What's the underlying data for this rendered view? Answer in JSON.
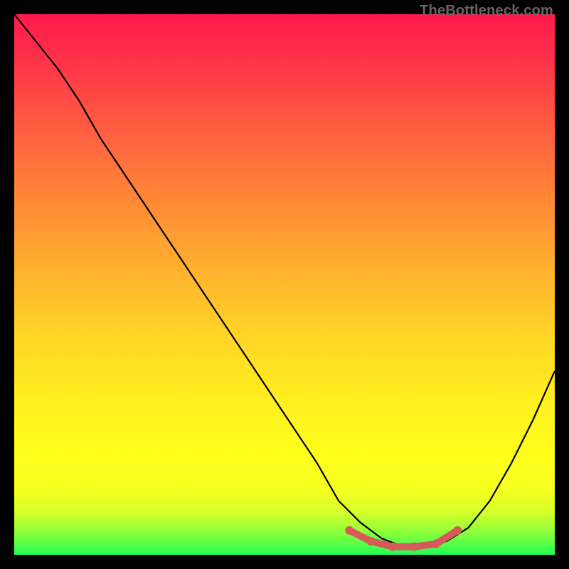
{
  "watermark": "TheBottleneck.com",
  "colors": {
    "curve": "#000000",
    "highlight": "#d65a5a",
    "gradient_top": "#ff1a4d",
    "gradient_bottom": "#20ff55",
    "frame": "#000000"
  },
  "chart_data": {
    "type": "line",
    "title": "",
    "xlabel": "",
    "ylabel": "",
    "xlim": [
      0,
      100
    ],
    "ylim": [
      0,
      100
    ],
    "grid": false,
    "legend": false,
    "x": [
      0,
      4,
      8,
      12,
      16,
      20,
      24,
      28,
      32,
      36,
      40,
      44,
      48,
      52,
      56,
      60,
      64,
      68,
      72,
      76,
      80,
      84,
      88,
      92,
      96,
      100
    ],
    "values": [
      100,
      95,
      90,
      84,
      77,
      71,
      65,
      59,
      53,
      47,
      41,
      35,
      29,
      23,
      17,
      10,
      6,
      3,
      1.5,
      1.5,
      2.5,
      5,
      10,
      17,
      25,
      34
    ],
    "highlight": {
      "x": [
        62,
        66,
        70,
        74,
        78,
        82
      ],
      "values": [
        4.5,
        2.5,
        1.5,
        1.5,
        2.0,
        4.5
      ]
    },
    "annotations": [
      "TheBottleneck.com"
    ]
  }
}
